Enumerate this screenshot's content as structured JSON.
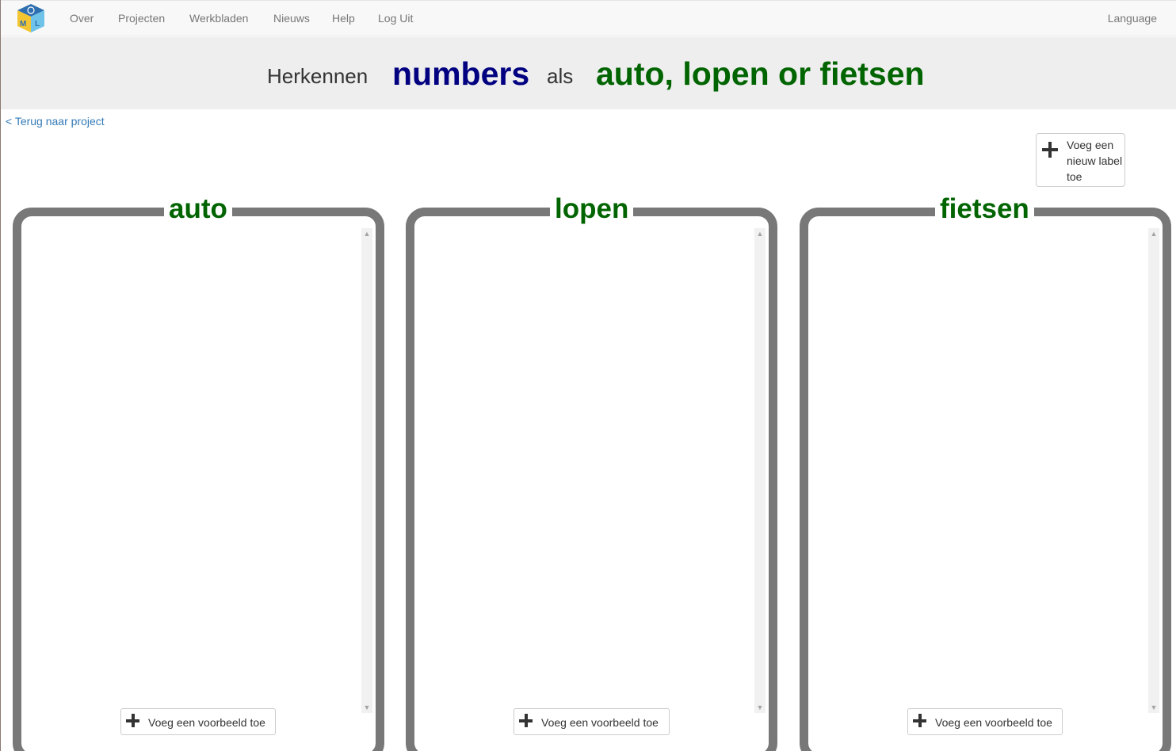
{
  "nav": {
    "logo_text": "ML",
    "items": [
      "Over",
      "Projecten",
      "Werkbladen",
      "Nieuws",
      "Help",
      "Log Uit"
    ],
    "language": "Language"
  },
  "header": {
    "recognise": "Herkennen",
    "type": "numbers",
    "as": "als",
    "labels_summary": "auto, lopen or fietsen"
  },
  "back_link": "< Terug naar project",
  "add_label_button": "Voeg een nieuw label toe",
  "buckets": [
    {
      "label": "auto",
      "add_example": "Voeg een voorbeeld toe"
    },
    {
      "label": "lopen",
      "add_example": "Voeg een voorbeeld toe"
    },
    {
      "label": "fietsen",
      "add_example": "Voeg een voorbeeld toe"
    }
  ],
  "icons": {
    "add": "plus-icon",
    "scroll_up": "chevron-up-icon",
    "scroll_down": "chevron-down-icon"
  },
  "colors": {
    "label_green": "#006400",
    "type_blue": "#000080",
    "link_blue": "#337ab7",
    "bucket_border": "#787878"
  }
}
